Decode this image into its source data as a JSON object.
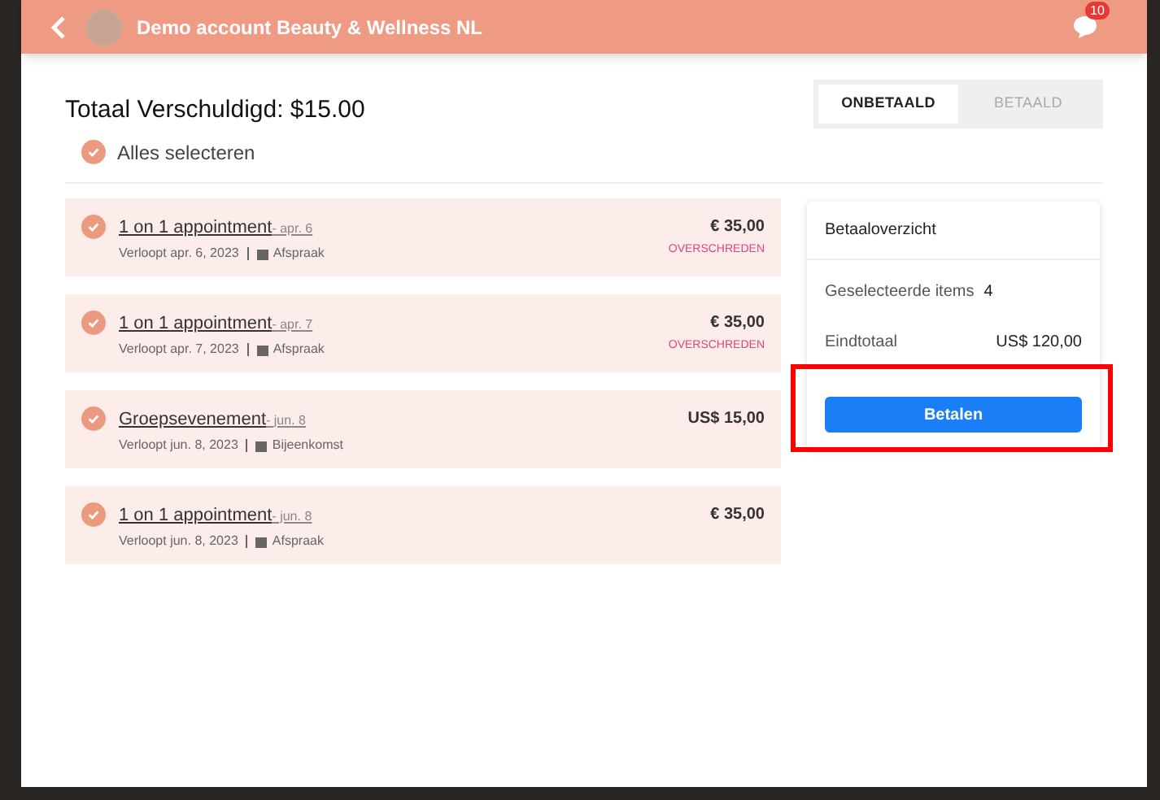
{
  "header": {
    "title": "Demo account Beauty & Wellness NL",
    "badge": "10"
  },
  "total": "Totaal Verschuldigd: $15.00",
  "select_all": {
    "label": "Alles selecteren",
    "checked": true
  },
  "tabs": [
    {
      "label": "ONBETAALD",
      "selected": true
    },
    {
      "label": "BETAALD",
      "selected": false
    }
  ],
  "items": [
    {
      "title": "1 on 1 appointment",
      "date": "- apr. 6",
      "expires": "Verloopt apr. 6, 2023",
      "type": "Afspraak",
      "amount": "€ 35,00",
      "status": "OVERSCHREDEN",
      "checked": true
    },
    {
      "title": "1 on 1 appointment",
      "date": "- apr. 7",
      "expires": "Verloopt apr. 7, 2023",
      "type": "Afspraak",
      "amount": "€ 35,00",
      "status": "OVERSCHREDEN",
      "checked": true
    },
    {
      "title": "Groepsevenement",
      "date": "- jun. 8",
      "expires": "Verloopt jun. 8, 2023",
      "type": "Bijeenkomst",
      "amount": "US$ 15,00",
      "checked": true
    },
    {
      "title": "1 on 1 appointment",
      "date": "- jun. 8",
      "expires": "Verloopt jun. 8, 2023",
      "type": "Afspraak",
      "amount": "€ 35,00",
      "checked": true
    }
  ],
  "summary": {
    "title": "Betaaloverzicht",
    "rows": [
      {
        "label": "Geselecteerde items",
        "value": "4"
      },
      {
        "label": "Eindtotaal",
        "value": "US$ 120,00"
      }
    ],
    "button": "Betalen"
  }
}
